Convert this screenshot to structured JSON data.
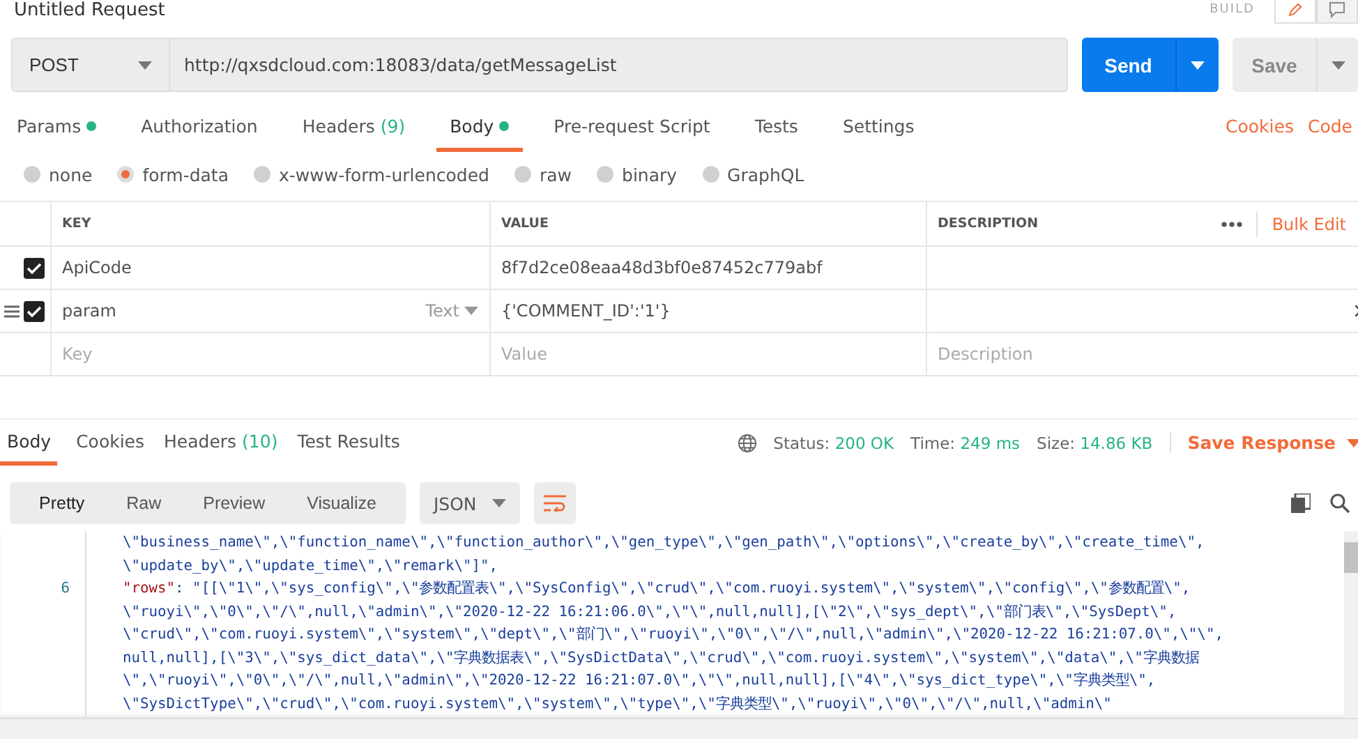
{
  "header": {
    "title": "Untitled Request",
    "mode": "BUILD",
    "toggles": [
      {
        "kind": "edit",
        "selected": true
      },
      {
        "kind": "comment",
        "selected": false
      }
    ]
  },
  "request": {
    "method": "POST",
    "url": "http://qxsdcloud.com:18083/data/getMessageList",
    "send": "Send",
    "save": "Save"
  },
  "tabs": [
    {
      "label": "Params",
      "dot": true,
      "selected": false
    },
    {
      "label": "Authorization",
      "dot": false,
      "selected": false
    },
    {
      "label": "Headers",
      "count": "(9)",
      "dot": false,
      "selected": false
    },
    {
      "label": "Body",
      "dot": true,
      "selected": true
    },
    {
      "label": "Pre-request Script",
      "dot": false,
      "selected": false
    },
    {
      "label": "Tests",
      "dot": false,
      "selected": false
    },
    {
      "label": "Settings",
      "dot": false,
      "selected": false
    }
  ],
  "links": [
    "Cookies",
    "Code"
  ],
  "body_types": [
    {
      "label": "none",
      "selected": false
    },
    {
      "label": "form-data",
      "selected": true
    },
    {
      "label": "x-www-form-urlencoded",
      "selected": false
    },
    {
      "label": "raw",
      "selected": false
    },
    {
      "label": "binary",
      "selected": false
    },
    {
      "label": "GraphQL",
      "selected": false
    }
  ],
  "table": {
    "columns": [
      "KEY",
      "VALUE",
      "DESCRIPTION"
    ],
    "bulk_edit": "Bulk Edit",
    "rows": [
      {
        "checked": true,
        "hovered": false,
        "key": "ApiCode",
        "value": "8f7d2ce08eaa48d3bf0e87452c779abf"
      },
      {
        "checked": true,
        "hovered": true,
        "key": "param",
        "type": "Text",
        "value": "{'COMMENT_ID':'1'}"
      }
    ],
    "placeholders": {
      "key": "Key",
      "value": "Value",
      "description": "Description"
    }
  },
  "response": {
    "tabs": [
      {
        "label": "Body",
        "selected": true
      },
      {
        "label": "Cookies",
        "selected": false
      },
      {
        "label": "Headers",
        "count": "(10)",
        "selected": false
      },
      {
        "label": "Test Results",
        "selected": false
      }
    ],
    "stats": [
      {
        "label": "Status:",
        "value": "200 OK"
      },
      {
        "label": "Time:",
        "value": "249 ms"
      },
      {
        "label": "Size:",
        "value": "14.86 KB"
      }
    ],
    "save_response": "Save Response",
    "views": [
      {
        "label": "Pretty",
        "selected": true
      },
      {
        "label": "Raw",
        "selected": false
      },
      {
        "label": "Preview",
        "selected": false
      },
      {
        "label": "Visualize",
        "selected": false
      }
    ],
    "format": "JSON",
    "code_lines": [
      {
        "text": "\\\"business_name\\\",\\\"function_name\\\",\\\"function_author\\\",\\\"gen_type\\\",\\\"gen_path\\\",\\\"options\\\",\\\"create_by\\\",\\\"create_time\\\","
      },
      {
        "text": "\\\"update_by\\\",\\\"update_time\\\",\\\"remark\\\"]\","
      },
      {
        "number": "6",
        "key": "\"rows\"",
        "text": ": \"[[\\\"1\\\",\\\"sys_config\\\",\\\"参数配置表\\\",\\\"SysConfig\\\",\\\"crud\\\",\\\"com.ruoyi.system\\\",\\\"system\\\",\\\"config\\\",\\\"参数配置\\\","
      },
      {
        "text": "\\\"ruoyi\\\",\\\"0\\\",\\\"/\\\",null,\\\"admin\\\",\\\"2020-12-22 16:21:06.0\\\",\\\"\\\",null,null],[\\\"2\\\",\\\"sys_dept\\\",\\\"部门表\\\",\\\"SysDept\\\","
      },
      {
        "text": "\\\"crud\\\",\\\"com.ruoyi.system\\\",\\\"system\\\",\\\"dept\\\",\\\"部门\\\",\\\"ruoyi\\\",\\\"0\\\",\\\"/\\\",null,\\\"admin\\\",\\\"2020-12-22 16:21:07.0\\\",\\\"\\\","
      },
      {
        "text": "null,null],[\\\"3\\\",\\\"sys_dict_data\\\",\\\"字典数据表\\\",\\\"SysDictData\\\",\\\"crud\\\",\\\"com.ruoyi.system\\\",\\\"system\\\",\\\"data\\\",\\\"字典数据"
      },
      {
        "text": "\\\",\\\"ruoyi\\\",\\\"0\\\",\\\"/\\\",null,\\\"admin\\\",\\\"2020-12-22 16:21:07.0\\\",\\\"\\\",null,null],[\\\"4\\\",\\\"sys_dict_type\\\",\\\"字典类型\\\","
      },
      {
        "text": "\\\"SysDictType\\\",\\\"crud\\\",\\\"com.ruoyi.system\\\",\\\"system\\\",\\\"type\\\",\\\"字典类型\\\",\\\"ruoyi\\\",\\\"0\\\",\\\"/\\\",null,\\\"admin\\\""
      }
    ]
  }
}
